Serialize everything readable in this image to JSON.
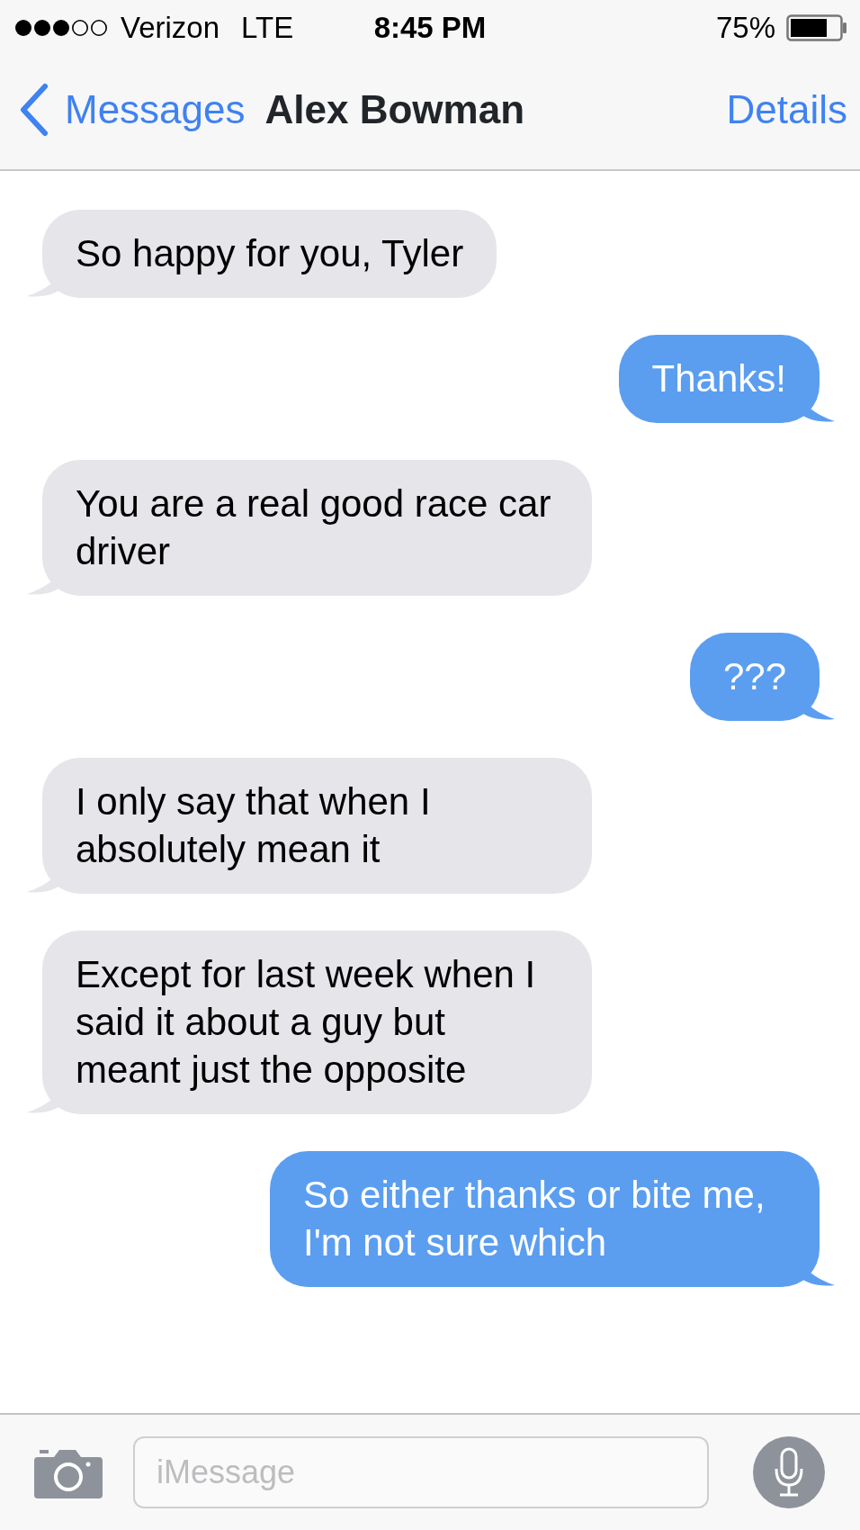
{
  "status_bar": {
    "carrier": "Verizon",
    "network": "LTE",
    "time": "8:45 PM",
    "battery": "75%"
  },
  "nav_bar": {
    "back": "Messages",
    "title": "Alex Bowman",
    "action": "Details"
  },
  "messages": [
    {
      "kind": "incoming",
      "text": "So happy for you, Tyler"
    },
    {
      "kind": "outgoing",
      "text": "Thanks!"
    },
    {
      "kind": "incoming",
      "text": "You are a real good race car driver"
    },
    {
      "kind": "outgoing",
      "text": "???"
    },
    {
      "kind": "incoming",
      "text": "I only say that when I absolutely mean it"
    },
    {
      "kind": "incoming",
      "text": "Except for last week when I said it about a guy but meant just the opposite"
    },
    {
      "kind": "outgoing",
      "text": "So either thanks or bite me, I'm not sure which"
    }
  ],
  "composer": {
    "placeholder": "iMessage"
  }
}
